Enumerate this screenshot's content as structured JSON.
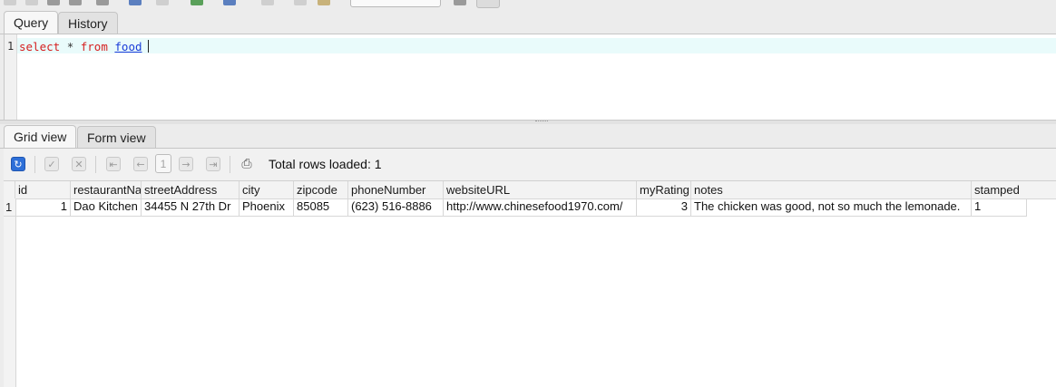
{
  "query_tabs": [
    {
      "label": "Query",
      "active": true
    },
    {
      "label": "History",
      "active": false
    }
  ],
  "editor": {
    "line_number": "1",
    "tokens": {
      "kw1": "select",
      "op": "*",
      "kw2": "from",
      "table": "food"
    }
  },
  "result_tabs": [
    {
      "label": "Grid view",
      "active": true
    },
    {
      "label": "Form view",
      "active": false
    }
  ],
  "result_toolbar": {
    "page": "1",
    "rows_loaded": "Total rows loaded: 1"
  },
  "grid": {
    "columns": [
      "id",
      "restaurantName",
      "streetAddress",
      "city",
      "zipcode",
      "phoneNumber",
      "websiteURL",
      "myRating",
      "notes",
      "stamped"
    ],
    "rows": [
      {
        "row_number": "1",
        "cells": [
          "1",
          "Dao Kitchen",
          "34455 N 27th Dr",
          "Phoenix",
          "85085",
          "(623) 516-8886",
          "http://www.chinesefood1970.com/",
          "3",
          "The chicken was good, not so much the lemonade.",
          "1"
        ]
      }
    ]
  },
  "colors": {
    "keyword": "#d62020",
    "identifier": "#1a3cd9",
    "current_line": "#e9fbfb",
    "refresh_icon": "#2d6fd8"
  }
}
